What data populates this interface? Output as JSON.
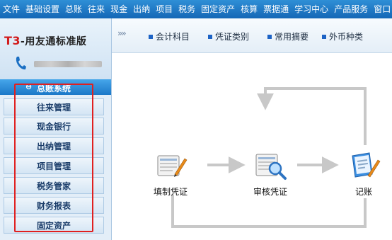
{
  "menu": [
    "文件",
    "基础设置",
    "总账",
    "往来",
    "现金",
    "出纳",
    "项目",
    "税务",
    "固定资产",
    "核算",
    "票据通",
    "学习中心",
    "产品服务",
    "窗口"
  ],
  "logo": {
    "title_prefix": "T3",
    "title_rest": "-用友通标准版"
  },
  "nav": {
    "header": "总账系统",
    "items": [
      "往来管理",
      "现金银行",
      "出纳管理",
      "项目管理",
      "税务管家",
      "财务报表",
      "固定资产"
    ]
  },
  "toolbar": {
    "chevron": "»»",
    "items": [
      "会计科目",
      "凭证类别",
      "常用摘要",
      "外币种类"
    ]
  },
  "flow": {
    "nodes": [
      {
        "label": "填制凭证",
        "icon": "fill-voucher-icon"
      },
      {
        "label": "审核凭证",
        "icon": "review-voucher-icon"
      },
      {
        "label": "记账",
        "icon": "post-ledger-icon"
      }
    ]
  },
  "colors": {
    "menubar": "#1a73c4",
    "nav_header": "#2b88d6",
    "highlight_box": "#e02020",
    "flow_arrow": "#c8c8c8"
  }
}
